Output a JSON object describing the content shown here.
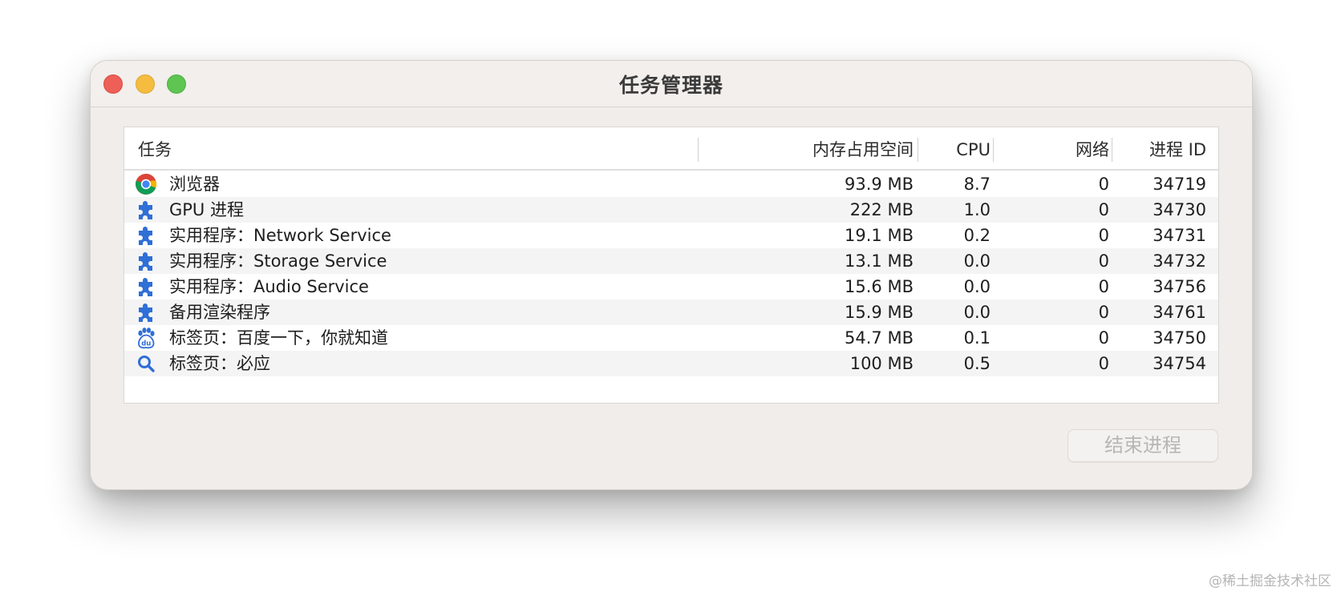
{
  "window": {
    "title": "任务管理器"
  },
  "table": {
    "headers": {
      "task": "任务",
      "memory": "内存占用空间",
      "cpu": "CPU",
      "network": "网络",
      "pid": "进程 ID"
    },
    "rows": [
      {
        "icon": "chrome-icon",
        "task": "浏览器",
        "memory": "93.9 MB",
        "cpu": "8.7",
        "network": "0",
        "pid": "34719"
      },
      {
        "icon": "puzzle-icon",
        "task": "GPU 进程",
        "memory": "222 MB",
        "cpu": "1.0",
        "network": "0",
        "pid": "34730"
      },
      {
        "icon": "puzzle-icon",
        "task": "实用程序：Network Service",
        "memory": "19.1 MB",
        "cpu": "0.2",
        "network": "0",
        "pid": "34731"
      },
      {
        "icon": "puzzle-icon",
        "task": "实用程序：Storage Service",
        "memory": "13.1 MB",
        "cpu": "0.0",
        "network": "0",
        "pid": "34732"
      },
      {
        "icon": "puzzle-icon",
        "task": "实用程序：Audio Service",
        "memory": "15.6 MB",
        "cpu": "0.0",
        "network": "0",
        "pid": "34756"
      },
      {
        "icon": "puzzle-icon",
        "task": "备用渲染程序",
        "memory": "15.9 MB",
        "cpu": "0.0",
        "network": "0",
        "pid": "34761"
      },
      {
        "icon": "baidu-paw-icon",
        "task": "标签页：百度一下，你就知道",
        "memory": "54.7 MB",
        "cpu": "0.1",
        "network": "0",
        "pid": "34750"
      },
      {
        "icon": "search-icon",
        "task": "标签页：必应",
        "memory": "100 MB",
        "cpu": "0.5",
        "network": "0",
        "pid": "34754"
      }
    ]
  },
  "actions": {
    "end_process": "结束进程"
  },
  "watermark": "@稀土掘金技术社区",
  "colors": {
    "close": "#ee5f57",
    "minimize": "#f5bd3f",
    "maximize": "#5fc552",
    "icon_blue": "#2f6fd6"
  }
}
